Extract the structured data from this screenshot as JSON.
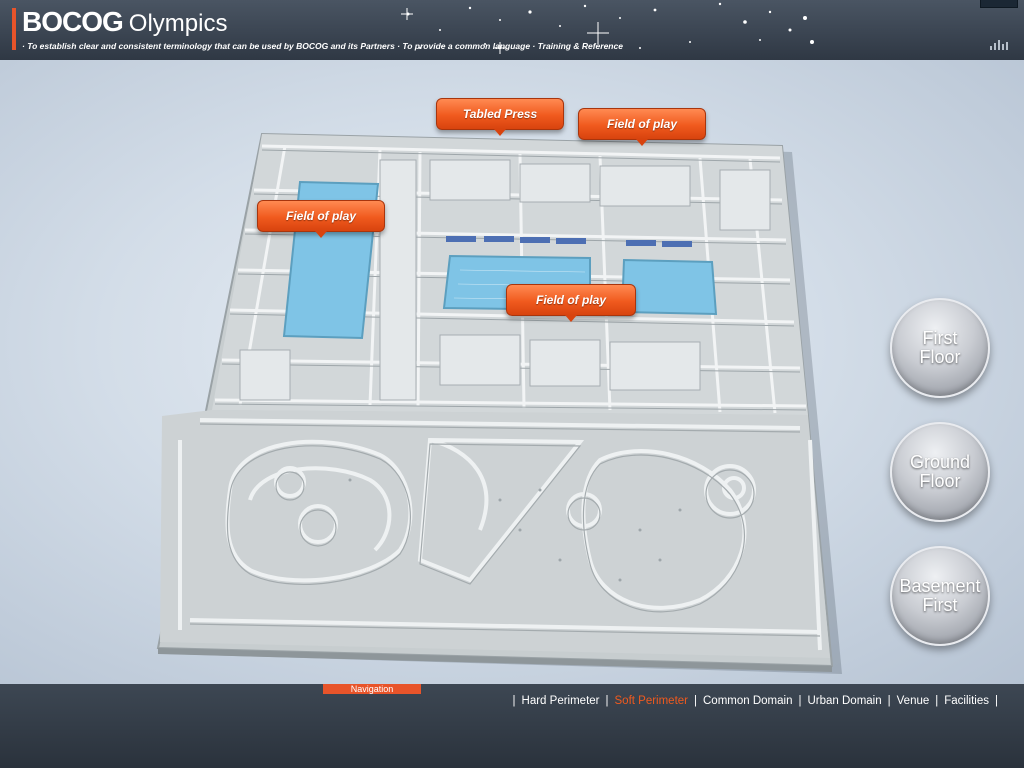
{
  "header": {
    "brand": "BOCOG",
    "title": "Olympics",
    "tagline": "· To establish clear and consistent terminology that can be used by BOCOG and its Partners · To provide a common language · Training & Reference"
  },
  "callouts": [
    {
      "label": "Tabled Press"
    },
    {
      "label": "Field of play"
    },
    {
      "label": "Field of play"
    },
    {
      "label": "Field of play"
    }
  ],
  "floors": [
    {
      "line1": "First",
      "line2": "Floor"
    },
    {
      "line1": "Ground",
      "line2": "Floor"
    },
    {
      "line1": "Basement",
      "line2": "First"
    }
  ],
  "footer": {
    "nav_tab": "Navigation",
    "links": [
      {
        "label": "Hard Perimeter",
        "active": false
      },
      {
        "label": "Soft Perimeter",
        "active": true
      },
      {
        "label": "Common Domain",
        "active": false
      },
      {
        "label": "Urban Domain",
        "active": false
      },
      {
        "label": "Venue",
        "active": false
      },
      {
        "label": "Facilities",
        "active": false
      }
    ]
  },
  "colors": {
    "accent": "#f05a1e",
    "pool": "#7fc4e6",
    "header_bg": "#2f3844"
  }
}
